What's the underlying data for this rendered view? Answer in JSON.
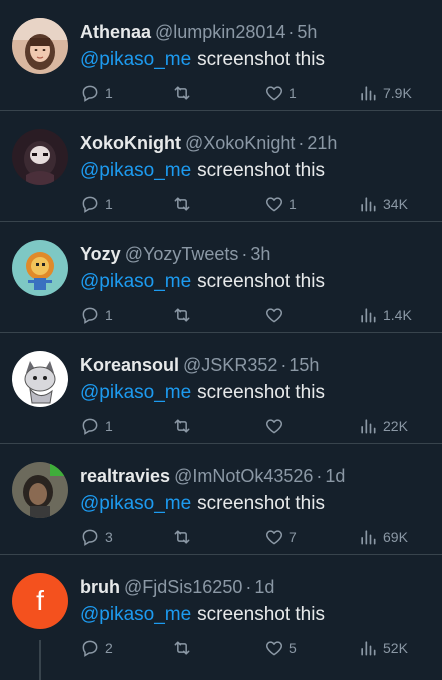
{
  "colors": {
    "background": "#15202b",
    "text_primary": "#e7e9ea",
    "text_secondary": "#8b98a5",
    "mention": "#1d9bf0",
    "divider": "#38444d"
  },
  "tweets": [
    {
      "name": "Athenaa",
      "handle": "@lumpkin28014",
      "time": "5h",
      "mention": "@pikaso_me",
      "text": "screenshot this",
      "replies": "1",
      "retweets": "",
      "likes": "1",
      "views": "7.9K",
      "avatar": "photo-girl-avatar"
    },
    {
      "name": "XokoKnight",
      "handle": "@XokoKnight",
      "time": "21h",
      "mention": "@pikaso_me",
      "text": "screenshot this",
      "replies": "1",
      "retweets": "",
      "likes": "1",
      "views": "34K",
      "avatar": "dark-character-avatar"
    },
    {
      "name": "Yozy",
      "handle": "@YozyTweets",
      "time": "3h",
      "mention": "@pikaso_me",
      "text": "screenshot this",
      "replies": "1",
      "retweets": "",
      "likes": "",
      "views": "1.4K",
      "avatar": "pixel-lion-avatar"
    },
    {
      "name": "Koreansoul",
      "handle": "@JSKR352",
      "time": "15h",
      "mention": "@pikaso_me",
      "text": "screenshot this",
      "replies": "1",
      "retweets": "",
      "likes": "",
      "views": "22K",
      "avatar": "cartoon-cat-avatar"
    },
    {
      "name": "realtravies",
      "handle": "@ImNotOk43526",
      "time": "1d",
      "mention": "@pikaso_me",
      "text": "screenshot this",
      "replies": "3",
      "retweets": "",
      "likes": "7",
      "views": "69K",
      "avatar": "photo-person-avatar"
    },
    {
      "name": "bruh",
      "handle": "@FjdSis16250",
      "time": "1d",
      "mention": "@pikaso_me",
      "text": "screenshot this",
      "replies": "2",
      "retweets": "",
      "likes": "5",
      "views": "52K",
      "avatar": "letter-avatar",
      "avatar_letter": "f"
    }
  ]
}
